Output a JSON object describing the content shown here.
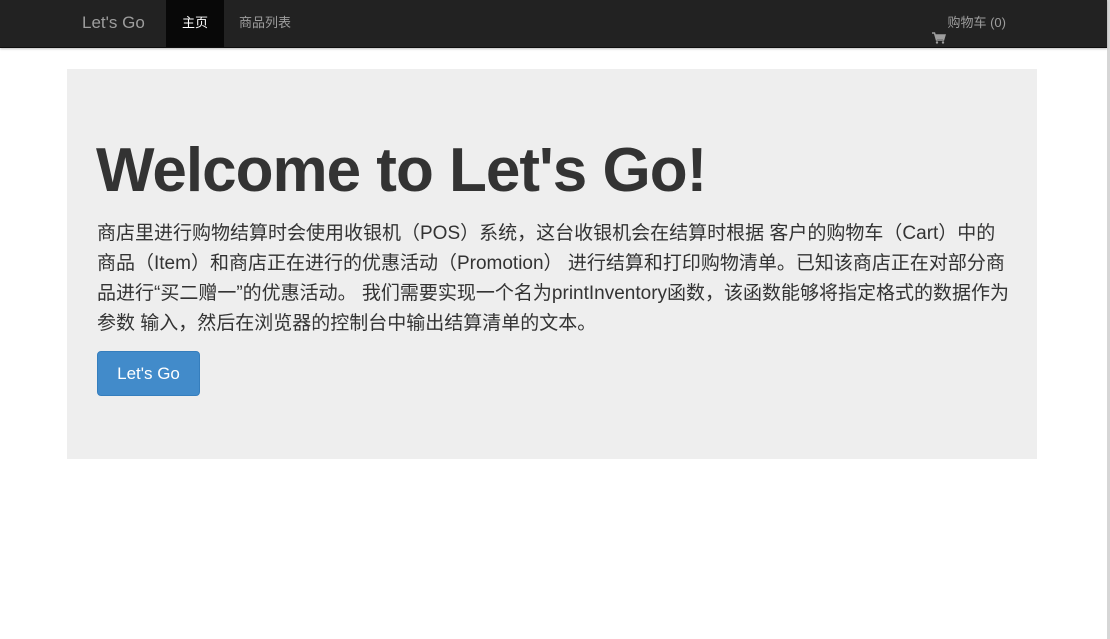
{
  "navbar": {
    "brand": "Let's Go",
    "items": [
      {
        "label": "主页",
        "active": true
      },
      {
        "label": "商品列表",
        "active": false
      }
    ],
    "cart": {
      "label": "购物车 (0)",
      "icon": "shopping-cart-icon"
    }
  },
  "jumbotron": {
    "title": "Welcome to Let's Go!",
    "text": "商店里进行购物结算时会使用收银机（POS）系统，这台收银机会在结算时根据 客户的购物车（Cart）中的商品（Item）和商店正在进行的优惠活动（Promotion） 进行结算和打印购物清单。已知该商店正在对部分商品进行“买二赠一”的优惠活动。 我们需要实现一个名为printInventory函数，该函数能够将指定格式的数据作为参数 输入，然后在浏览器的控制台中输出结算清单的文本。",
    "button_label": "Let's Go"
  },
  "colors": {
    "navbar_bg": "#222222",
    "jumbotron_bg": "#eeeeee",
    "primary": "#428bca"
  }
}
